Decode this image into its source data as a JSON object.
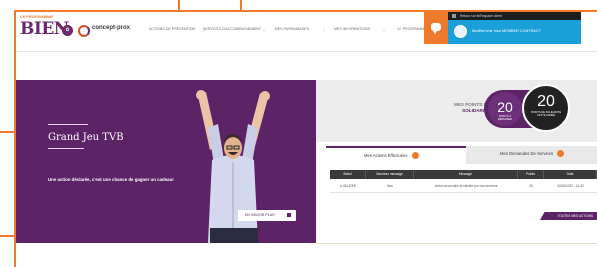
{
  "header": {
    "logo_small": "LE PROGRAMME",
    "logo_big": "BIEN",
    "brand_name": "concept-prox",
    "brand_tagline": "",
    "nav": [
      {
        "label": "ACTIONS DE PRÉVENTION"
      },
      {
        "label": "SERVICES D'ACCOMPAGNEMENT"
      },
      {
        "label": "MES PARRAINAGES"
      },
      {
        "label": "MES INFORMATIONS"
      },
      {
        "label": "LE PROGRAMME"
      }
    ],
    "topbar_text": "Retour sur le/l'espace client",
    "user_name": "Modifier/voir mon MEMBER CONTRACT"
  },
  "hero": {
    "title": "Grand Jeu TVB",
    "text": "Une action déclarée, c'est une chance de gagner un cadeau!",
    "button_label": "EN SAVOIR PLUS"
  },
  "points": {
    "label_line1": "MES POINTS DE",
    "label_line2": "SOLIDARITÉ",
    "circle_a_value": "20",
    "circle_a_caption": "POINTS À DÉPENSER",
    "circle_b_value": "20",
    "circle_b_caption": "POINTS DE SOLIDARITÉ CETTE ANNÉE"
  },
  "tabs": [
    {
      "label": "Mes Actions Effectuées"
    },
    {
      "label": "Mes Demandes De Services"
    }
  ],
  "table": {
    "columns": [
      "Statut",
      "Nouveau message",
      "Message",
      "Points",
      "Date"
    ],
    "rows": [
      {
        "statut": "● VALIDÉE",
        "nouveau": "Non",
        "message": "Action accomplie et validée par nos services",
        "points": "20",
        "date": "02/06/2020 - 14:32"
      }
    ]
  },
  "see_all_label": "TOUTES MES ACTIONS",
  "colors": {
    "accent_orange": "#f07a2b",
    "brand_purple": "#5c2466",
    "user_blue": "#1a9fd9"
  }
}
